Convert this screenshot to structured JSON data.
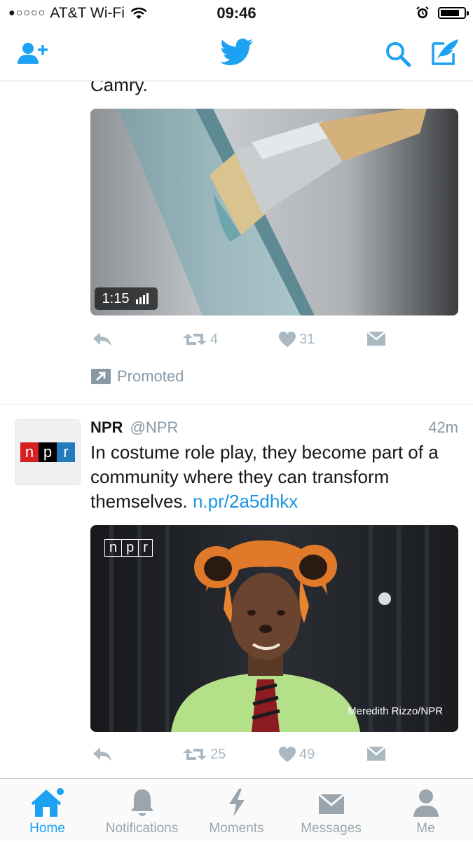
{
  "status_bar": {
    "signal": "●○○○○",
    "carrier": "AT&T Wi-Fi",
    "time": "09:46"
  },
  "feed": {
    "prev_tweet": {
      "text_tail": "Camry.",
      "video_duration": "1:15",
      "retweet_count": "4",
      "like_count": "31",
      "promoted_label": "Promoted"
    },
    "tweet": {
      "name": "NPR",
      "handle": "@NPR",
      "time": "42m",
      "text": "In costume role play, they become part of a community where they can transform themselves.",
      "link": "n.pr/2a5dhkx",
      "avatar_logo": [
        "n",
        "p",
        "r"
      ],
      "image_watermark": "npr",
      "image_credit": "Meredith Rizzo/NPR",
      "retweet_count": "25",
      "like_count": "49"
    }
  },
  "tabs": [
    {
      "label": "Home",
      "icon": "home-icon",
      "active": true
    },
    {
      "label": "Notifications",
      "icon": "bell-icon",
      "active": false
    },
    {
      "label": "Moments",
      "icon": "lightning-icon",
      "active": false
    },
    {
      "label": "Messages",
      "icon": "envelope-icon",
      "active": false
    },
    {
      "label": "Me",
      "icon": "person-icon",
      "active": false
    }
  ],
  "colors": {
    "accent": "#1da1f2",
    "link": "#1b95e0",
    "muted": "#aab8c2",
    "npr_red": "#d62021",
    "npr_black": "#000000",
    "npr_blue": "#237bbd"
  }
}
